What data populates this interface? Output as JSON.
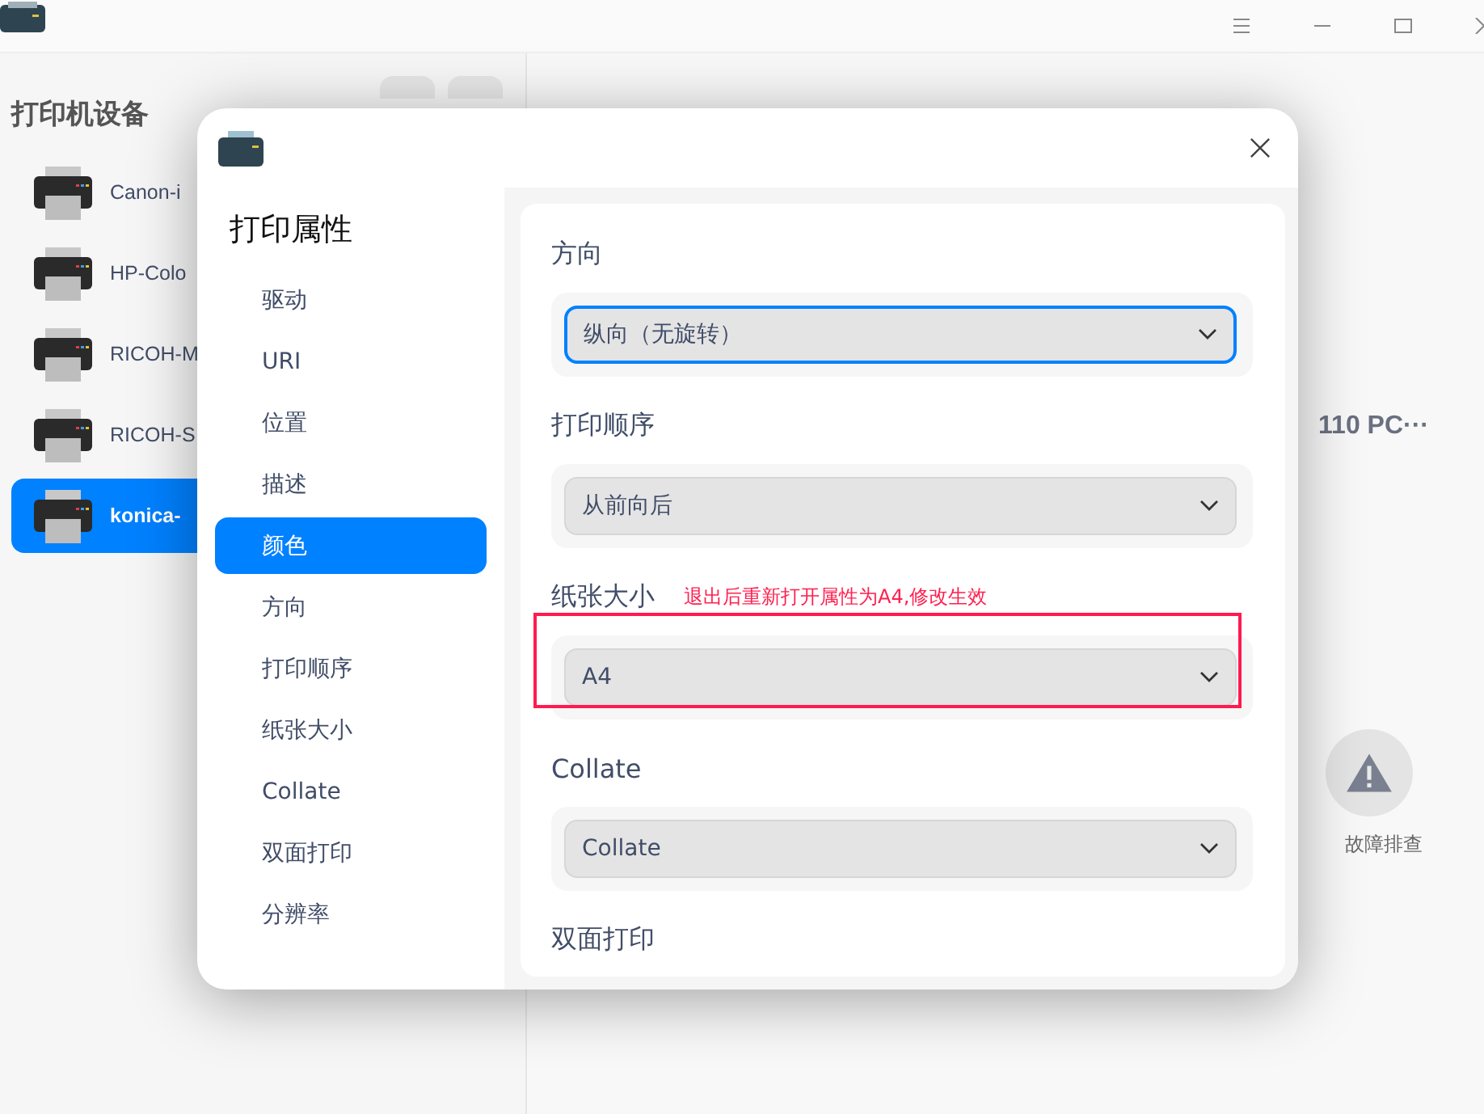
{
  "sidebar": {
    "title": "打印机设备",
    "printers": [
      {
        "name": "Canon-i",
        "selected": false
      },
      {
        "name": "HP-Colo",
        "selected": false
      },
      {
        "name": "RICOH-M",
        "selected": false
      },
      {
        "name": "RICOH-S",
        "selected": false
      },
      {
        "name": "konica-",
        "selected": true
      }
    ]
  },
  "main": {
    "printer_name": "110 PC···",
    "troubleshoot": "故障排查"
  },
  "dialog": {
    "title": "打印属性",
    "nav": [
      {
        "label": "驱动",
        "selected": false
      },
      {
        "label": "URI",
        "selected": false
      },
      {
        "label": "位置",
        "selected": false
      },
      {
        "label": "描述",
        "selected": false
      },
      {
        "label": "颜色",
        "selected": true
      },
      {
        "label": "方向",
        "selected": false
      },
      {
        "label": "打印顺序",
        "selected": false
      },
      {
        "label": "纸张大小",
        "selected": false
      },
      {
        "label": "Collate",
        "selected": false
      },
      {
        "label": "双面打印",
        "selected": false
      },
      {
        "label": "分辨率",
        "selected": false
      }
    ],
    "sections": [
      {
        "heading": "方向",
        "value": "纵向（无旋转）",
        "focused": true,
        "annotated": false
      },
      {
        "heading": "打印顺序",
        "value": "从前向后",
        "focused": false,
        "annotated": false
      },
      {
        "heading": "纸张大小",
        "note": "退出后重新打开属性为A4,修改生效",
        "value": "A4",
        "focused": false,
        "annotated": true
      },
      {
        "heading": "Collate",
        "value": "Collate",
        "focused": false,
        "annotated": false
      },
      {
        "heading": "双面打印"
      }
    ]
  }
}
